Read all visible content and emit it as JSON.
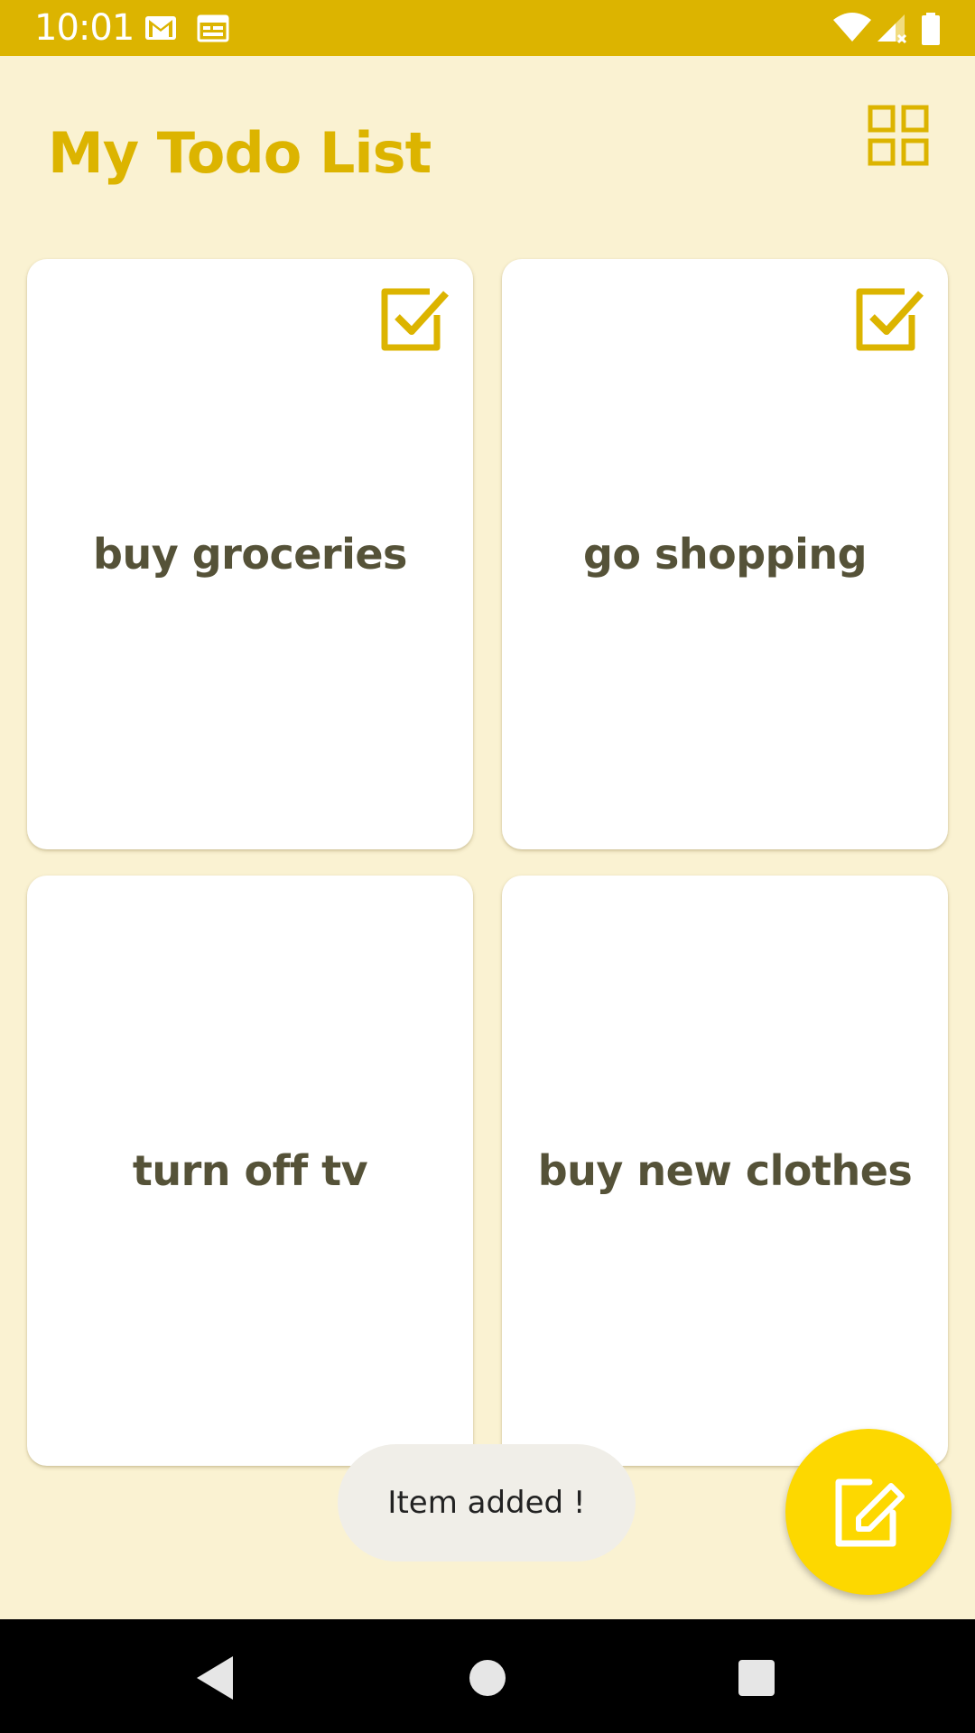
{
  "status_bar": {
    "time": "10:01",
    "left_icons": [
      "gmail-icon",
      "calendar-icon"
    ],
    "right_icons": [
      "wifi-icon",
      "cell-signal-icon",
      "battery-icon"
    ]
  },
  "header": {
    "title": "My Todo List",
    "layout_toggle_icon": "grid-view-icon"
  },
  "todos": [
    {
      "label": "buy groceries",
      "completed": true
    },
    {
      "label": "go shopping",
      "completed": true
    },
    {
      "label": "turn off tv",
      "completed": false
    },
    {
      "label": "buy new clothes",
      "completed": false
    }
  ],
  "toast": {
    "message": "Item added !"
  },
  "fab": {
    "icon": "edit-icon"
  },
  "nav_bar": {
    "icons": [
      "back-icon",
      "home-icon",
      "recents-icon"
    ]
  },
  "colors": {
    "accent": "#dcb400",
    "background": "#faf2d2",
    "card_text": "#555238",
    "fab": "#fdd800"
  }
}
